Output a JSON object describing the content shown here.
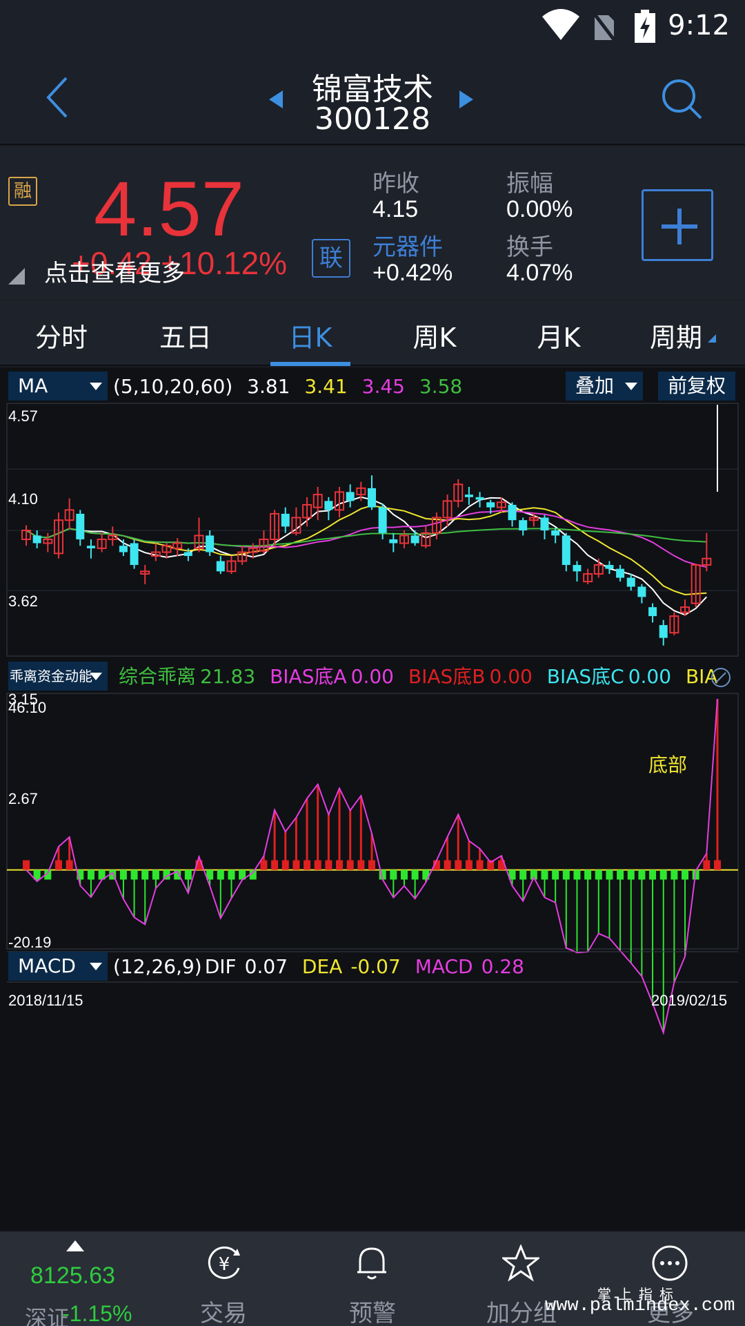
{
  "status_bar": {
    "time": "9:12"
  },
  "header": {
    "title": "锦富技术",
    "code": "300128"
  },
  "quote": {
    "rong": "融",
    "price": "4.57",
    "change": "+0.42  +10.12%",
    "more_hint": "点击查看更多",
    "lian": "联",
    "prev_close_label": "昨收",
    "prev_close": "4.15",
    "amplitude_label": "振幅",
    "amplitude": "0.00%",
    "sector": "元器件",
    "sector_change": "+0.42%",
    "turnover_label": "换手",
    "turnover": "4.07%"
  },
  "tabs": [
    "分时",
    "五日",
    "日K",
    "周K",
    "月K",
    "周期"
  ],
  "active_tab": "日K",
  "main_indicator": {
    "name": "MA",
    "params": "(5,10,20,60)",
    "values": [
      "3.81",
      "3.41",
      "3.45",
      "3.58"
    ],
    "colors": [
      "#ffffff",
      "#f1e630",
      "#e53de0",
      "#3fbf3f"
    ],
    "overlay_label": "叠加",
    "adjust_label": "前复权"
  },
  "sub_indicator": {
    "name": "乖离资金动能",
    "items": [
      {
        "label": "综合乖离",
        "value": "21.83",
        "color": "#3fbf3f"
      },
      {
        "label": "BIAS底A",
        "value": "0.00",
        "color": "#e53de0"
      },
      {
        "label": "BIAS底B",
        "value": "0.00",
        "color": "#e02020"
      },
      {
        "label": "BIAS底C",
        "value": "0.00",
        "color": "#3ee6f0"
      },
      {
        "label": "BIAS",
        "value": "",
        "color": "#f1e630"
      }
    ],
    "annotation": "底部"
  },
  "macd": {
    "name": "MACD",
    "params": "(12,26,9)",
    "dif_label": "DIF",
    "dif": "0.07",
    "dea_label": "DEA",
    "dea": "-0.07",
    "macd_label": "MACD",
    "macd": "0.28"
  },
  "dates": {
    "start": "2018/11/15",
    "end": "2019/02/15"
  },
  "chart_data": {
    "type": "candlestick",
    "price_axis": {
      "max": "4.57",
      "ticks": [
        "4.10",
        "3.62",
        "3.15"
      ],
      "min": "2.67"
    },
    "sub_axis": {
      "max": "46.10",
      "min": "-20.19"
    },
    "candles": [
      [
        3.55,
        3.62,
        3.66,
        3.5
      ],
      [
        3.58,
        3.52,
        3.62,
        3.48
      ],
      [
        3.52,
        3.55,
        3.6,
        3.45
      ],
      [
        3.44,
        3.7,
        3.76,
        3.4
      ],
      [
        3.7,
        3.78,
        3.87,
        3.63
      ],
      [
        3.75,
        3.55,
        3.78,
        3.5
      ],
      [
        3.5,
        3.48,
        3.55,
        3.4
      ],
      [
        3.48,
        3.55,
        3.6,
        3.45
      ],
      [
        3.55,
        3.58,
        3.65,
        3.5
      ],
      [
        3.5,
        3.45,
        3.55,
        3.42
      ],
      [
        3.52,
        3.35,
        3.55,
        3.32
      ],
      [
        3.28,
        3.3,
        3.35,
        3.2
      ],
      [
        3.42,
        3.45,
        3.52,
        3.38
      ],
      [
        3.45,
        3.5,
        3.52,
        3.4
      ],
      [
        3.48,
        3.52,
        3.56,
        3.42
      ],
      [
        3.45,
        3.42,
        3.48,
        3.38
      ],
      [
        3.48,
        3.58,
        3.72,
        3.45
      ],
      [
        3.58,
        3.45,
        3.62,
        3.42
      ],
      [
        3.38,
        3.3,
        3.42,
        3.28
      ],
      [
        3.3,
        3.38,
        3.42,
        3.28
      ],
      [
        3.38,
        3.45,
        3.5,
        3.35
      ],
      [
        3.45,
        3.48,
        3.52,
        3.4
      ],
      [
        3.46,
        3.55,
        3.62,
        3.44
      ],
      [
        3.55,
        3.75,
        3.78,
        3.5
      ],
      [
        3.75,
        3.65,
        3.8,
        3.6
      ],
      [
        3.6,
        3.72,
        3.8,
        3.58
      ],
      [
        3.72,
        3.82,
        3.88,
        3.65
      ],
      [
        3.8,
        3.9,
        3.96,
        3.7
      ],
      [
        3.85,
        3.78,
        3.88,
        3.7
      ],
      [
        3.78,
        3.92,
        3.96,
        3.72
      ],
      [
        3.92,
        3.85,
        3.98,
        3.8
      ],
      [
        3.9,
        3.95,
        4.0,
        3.85
      ],
      [
        3.95,
        3.8,
        4.05,
        3.78
      ],
      [
        3.8,
        3.6,
        3.83,
        3.55
      ],
      [
        3.55,
        3.52,
        3.6,
        3.45
      ],
      [
        3.52,
        3.58,
        3.62,
        3.48
      ],
      [
        3.58,
        3.52,
        3.62,
        3.5
      ],
      [
        3.5,
        3.6,
        3.65,
        3.48
      ],
      [
        3.6,
        3.72,
        3.76,
        3.55
      ],
      [
        3.72,
        3.85,
        3.9,
        3.65
      ],
      [
        3.85,
        3.98,
        4.02,
        3.8
      ],
      [
        3.9,
        3.88,
        3.96,
        3.82
      ],
      [
        3.88,
        3.86,
        3.92,
        3.8
      ],
      [
        3.84,
        3.8,
        3.86,
        3.75
      ],
      [
        3.8,
        3.84,
        3.88,
        3.76
      ],
      [
        3.82,
        3.7,
        3.84,
        3.65
      ],
      [
        3.7,
        3.62,
        3.72,
        3.58
      ],
      [
        3.7,
        3.72,
        3.76,
        3.65
      ],
      [
        3.72,
        3.62,
        3.74,
        3.55
      ],
      [
        3.62,
        3.58,
        3.64,
        3.52
      ],
      [
        3.58,
        3.35,
        3.6,
        3.3
      ],
      [
        3.35,
        3.3,
        3.38,
        3.22
      ],
      [
        3.22,
        3.28,
        3.32,
        3.2
      ],
      [
        3.28,
        3.35,
        3.4,
        3.25
      ],
      [
        3.35,
        3.32,
        3.38,
        3.28
      ],
      [
        3.32,
        3.25,
        3.35,
        3.22
      ],
      [
        3.25,
        3.18,
        3.28,
        3.15
      ],
      [
        3.18,
        3.1,
        3.2,
        3.05
      ],
      [
        3.02,
        2.95,
        3.05,
        2.9
      ],
      [
        2.88,
        2.78,
        2.92,
        2.72
      ],
      [
        2.82,
        2.95,
        2.98,
        2.8
      ],
      [
        2.98,
        3.02,
        3.08,
        2.95
      ],
      [
        3.05,
        3.35,
        3.36,
        3.02
      ],
      [
        3.35,
        3.4,
        3.6,
        3.3
      ],
      [
        4.57,
        4.57,
        4.57,
        4.57
      ]
    ]
  },
  "bottom_nav": {
    "index_value": "8125.63",
    "index_name": "深证",
    "index_change": "-1.15%",
    "items": [
      "交易",
      "预警",
      "加分组",
      "更多"
    ]
  },
  "watermark_top": "掌上指标",
  "watermark": "www.palmindex.com"
}
